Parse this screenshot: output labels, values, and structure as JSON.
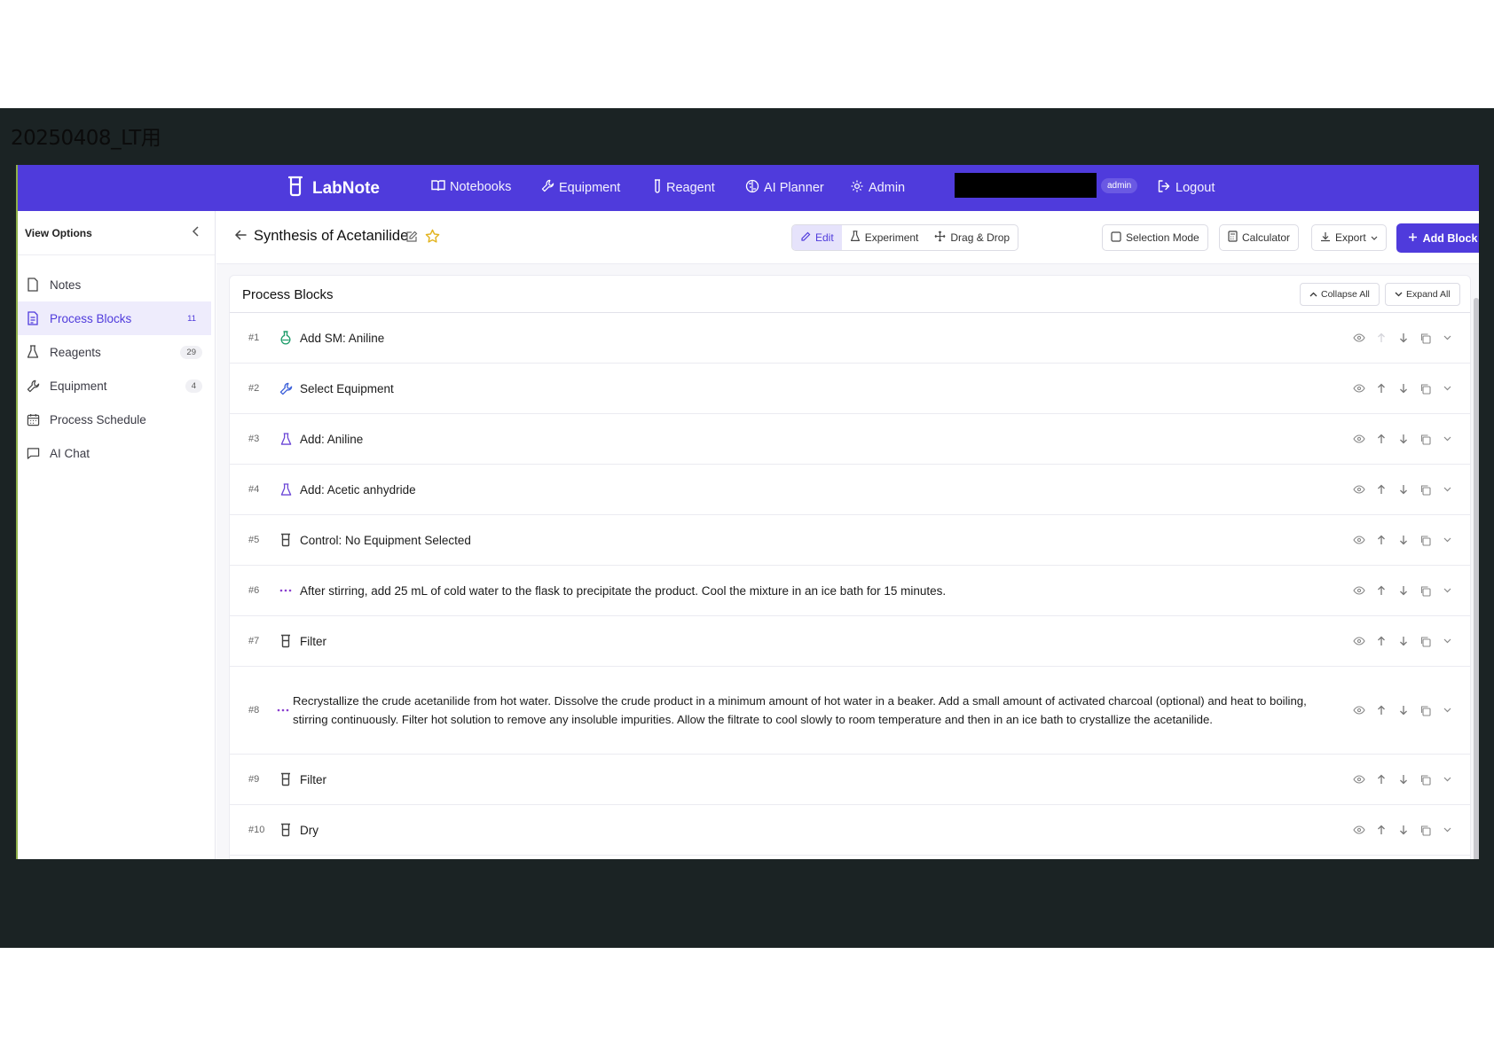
{
  "slide": {
    "title": "20250408_LT用"
  },
  "nav": {
    "brand": "LabNote",
    "items": [
      "Notebooks",
      "Equipment",
      "Reagent",
      "AI Planner",
      "Admin"
    ],
    "role_badge": "admin",
    "logout": "Logout"
  },
  "sidebar": {
    "header": "View Options",
    "items": [
      {
        "label": "Notes",
        "count": ""
      },
      {
        "label": "Process Blocks",
        "count": "11"
      },
      {
        "label": "Reagents",
        "count": "29"
      },
      {
        "label": "Equipment",
        "count": "4"
      },
      {
        "label": "Process Schedule",
        "count": ""
      },
      {
        "label": "AI Chat",
        "count": ""
      }
    ]
  },
  "header": {
    "title": "Synthesis of Acetanilide",
    "modes": [
      "Edit",
      "Experiment",
      "Drag & Drop"
    ],
    "selection_mode": "Selection Mode",
    "calculator": "Calculator",
    "export": "Export",
    "add_block": "Add Block"
  },
  "panel": {
    "title": "Process Blocks",
    "collapse_all": "Collapse All",
    "expand_all": "Expand All",
    "blocks": [
      {
        "num": "#1",
        "icon": "flask-icon",
        "text": "Add SM: Aniline"
      },
      {
        "num": "#2",
        "icon": "wrench-icon",
        "text": "Select Equipment"
      },
      {
        "num": "#3",
        "icon": "beaker-icon",
        "text": "Add: Aniline"
      },
      {
        "num": "#4",
        "icon": "beaker-icon",
        "text": "Add: Acetic anhydride"
      },
      {
        "num": "#5",
        "icon": "control-icon",
        "text": "Control: No Equipment Selected"
      },
      {
        "num": "#6",
        "icon": "dots-icon",
        "text": "After stirring, add 25 mL of cold water to the flask to precipitate the product. Cool the mixture in an ice bath for 15 minutes."
      },
      {
        "num": "#7",
        "icon": "control-icon",
        "text": "Filter"
      },
      {
        "num": "#8",
        "icon": "dots-icon",
        "text": "Recrystallize the crude acetanilide from hot water. Dissolve the crude product in a minimum amount of hot water in a beaker. Add a small amount of activated charcoal (optional) and heat to boiling, stirring continuously. Filter hot solution to remove any insoluble impurities. Allow the filtrate to cool slowly to room temperature and then in an ice bath to crystallize the acetanilide."
      },
      {
        "num": "#9",
        "icon": "control-icon",
        "text": "Filter"
      },
      {
        "num": "#10",
        "icon": "control-icon",
        "text": "Dry"
      }
    ]
  },
  "colors": {
    "brand": "#4f3bdc",
    "flask_green": "#1f9d6b",
    "wrench_blue": "#3b5fd9",
    "beaker_purple": "#6b46d6",
    "dots_purple": "#8a3fcf",
    "slide_bg": "#1b2324"
  }
}
